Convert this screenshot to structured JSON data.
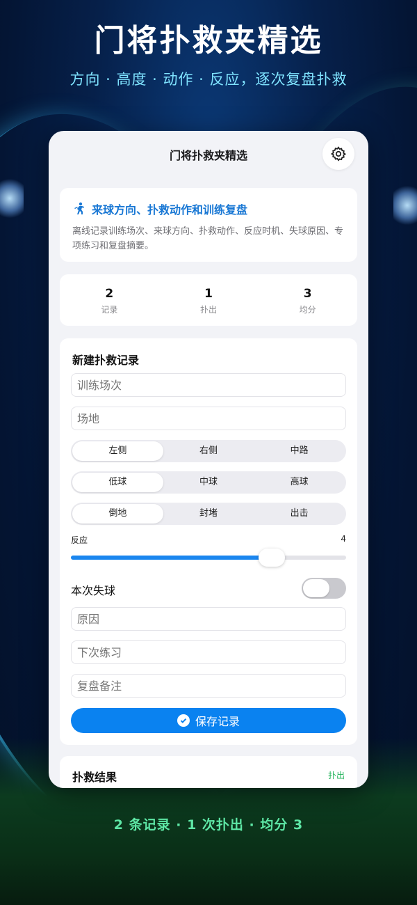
{
  "hero": {
    "title": "门将扑救夹精选",
    "subtitle": "方向 · 高度 · 动作 · 反应，逐次复盘扑救"
  },
  "app": {
    "title": "门将扑救夹精选",
    "settings_icon": "gear-icon"
  },
  "intro": {
    "icon": "goalkeeper-icon",
    "title": "来球方向、扑救动作和训练复盘",
    "description": "离线记录训练场次、来球方向、扑救动作、反应时机、失球原因、专项练习和复盘摘要。"
  },
  "stats": [
    {
      "value": "2",
      "label": "记录"
    },
    {
      "value": "1",
      "label": "扑出"
    },
    {
      "value": "3",
      "label": "均分"
    }
  ],
  "form": {
    "title": "新建扑救记录",
    "session_placeholder": "训练场次",
    "venue_placeholder": "场地",
    "direction": {
      "options": [
        "左侧",
        "右侧",
        "中路"
      ],
      "selected": "左侧"
    },
    "height": {
      "options": [
        "低球",
        "中球",
        "高球"
      ],
      "selected": "低球"
    },
    "action": {
      "options": [
        "倒地",
        "封堵",
        "出击"
      ],
      "selected": "倒地"
    },
    "reaction": {
      "label": "反应",
      "value": "4",
      "level": 0.73
    },
    "conceded": {
      "label": "本次失球",
      "on": false
    },
    "reason_placeholder": "原因",
    "next_practice_placeholder": "下次练习",
    "review_placeholder": "复盘备注",
    "save_label": "保存记录"
  },
  "results": {
    "title": "扑救结果",
    "badge": "扑出"
  },
  "footer": "2 条记录 · 1 次扑出 · 均分 3",
  "colors": {
    "accent": "#0a82f0",
    "intro_title": "#1877d4",
    "success": "#22b35a",
    "footer": "#5ee7a6",
    "subtitle": "#7fe3ff"
  }
}
